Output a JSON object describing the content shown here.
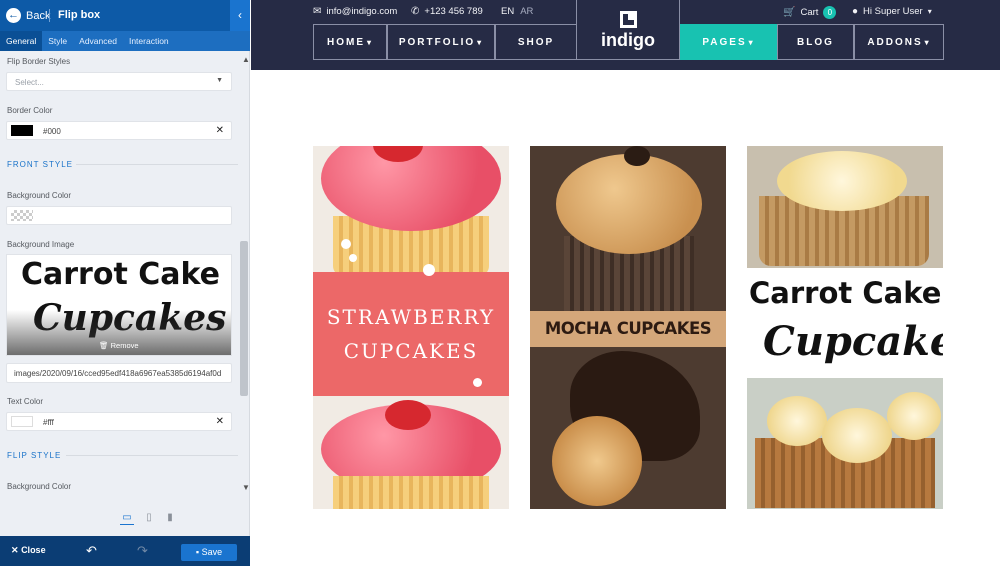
{
  "editor": {
    "back_label": "Back",
    "title": "Flip box",
    "tabs": [
      "General",
      "Style",
      "Advanced",
      "Interaction"
    ],
    "flip_border_styles_label": "Flip Border Styles",
    "flip_border_styles_placeholder": "Select...",
    "border_color_label": "Border Color",
    "border_color_value": "#000",
    "front_style_heading": "FRONT STYLE",
    "front_bg_color_label": "Background Color",
    "front_bg_image_label": "Background Image",
    "bg_image_text_line1": "Carrot Cake",
    "bg_image_text_line2": "Cupcakes",
    "remove_label": "Remove",
    "image_path": "images/2020/09/16/cced95edf418a6967ea5385d6194af0d",
    "text_color_label": "Text Color",
    "text_color_value": "#fff",
    "flip_style_heading": "FLIP STYLE",
    "flip_bg_color_label": "Background Color",
    "close_label": "Close",
    "save_label": "Save"
  },
  "site": {
    "email": "info@indigo.com",
    "phone": "+123 456 789",
    "lang_en": "EN",
    "lang_ar": "AR",
    "logo": "indigo",
    "cart_label": "Cart",
    "cart_count": "0",
    "user_label": "Hi Super User",
    "nav": {
      "home": "HOME",
      "portfolio": "PORTFOLIO",
      "shop": "SHOP",
      "pages": "PAGES",
      "blog": "BLOG",
      "addons": "ADDONS"
    },
    "cards": {
      "strawberry_line1": "STRAWBERRY",
      "strawberry_line2": "CUPCAKES",
      "mocha": "MOCHA CUPCAKES",
      "carrot_line1": "Carrot Cake",
      "carrot_line2": "Cupcakes"
    }
  },
  "colors": {
    "editor_header": "#0d5aa7",
    "nav_bg": "#262b45",
    "nav_active": "#18c2b1",
    "strawberry_band": "#ec6868",
    "mocha_band": "#d4a77a"
  }
}
